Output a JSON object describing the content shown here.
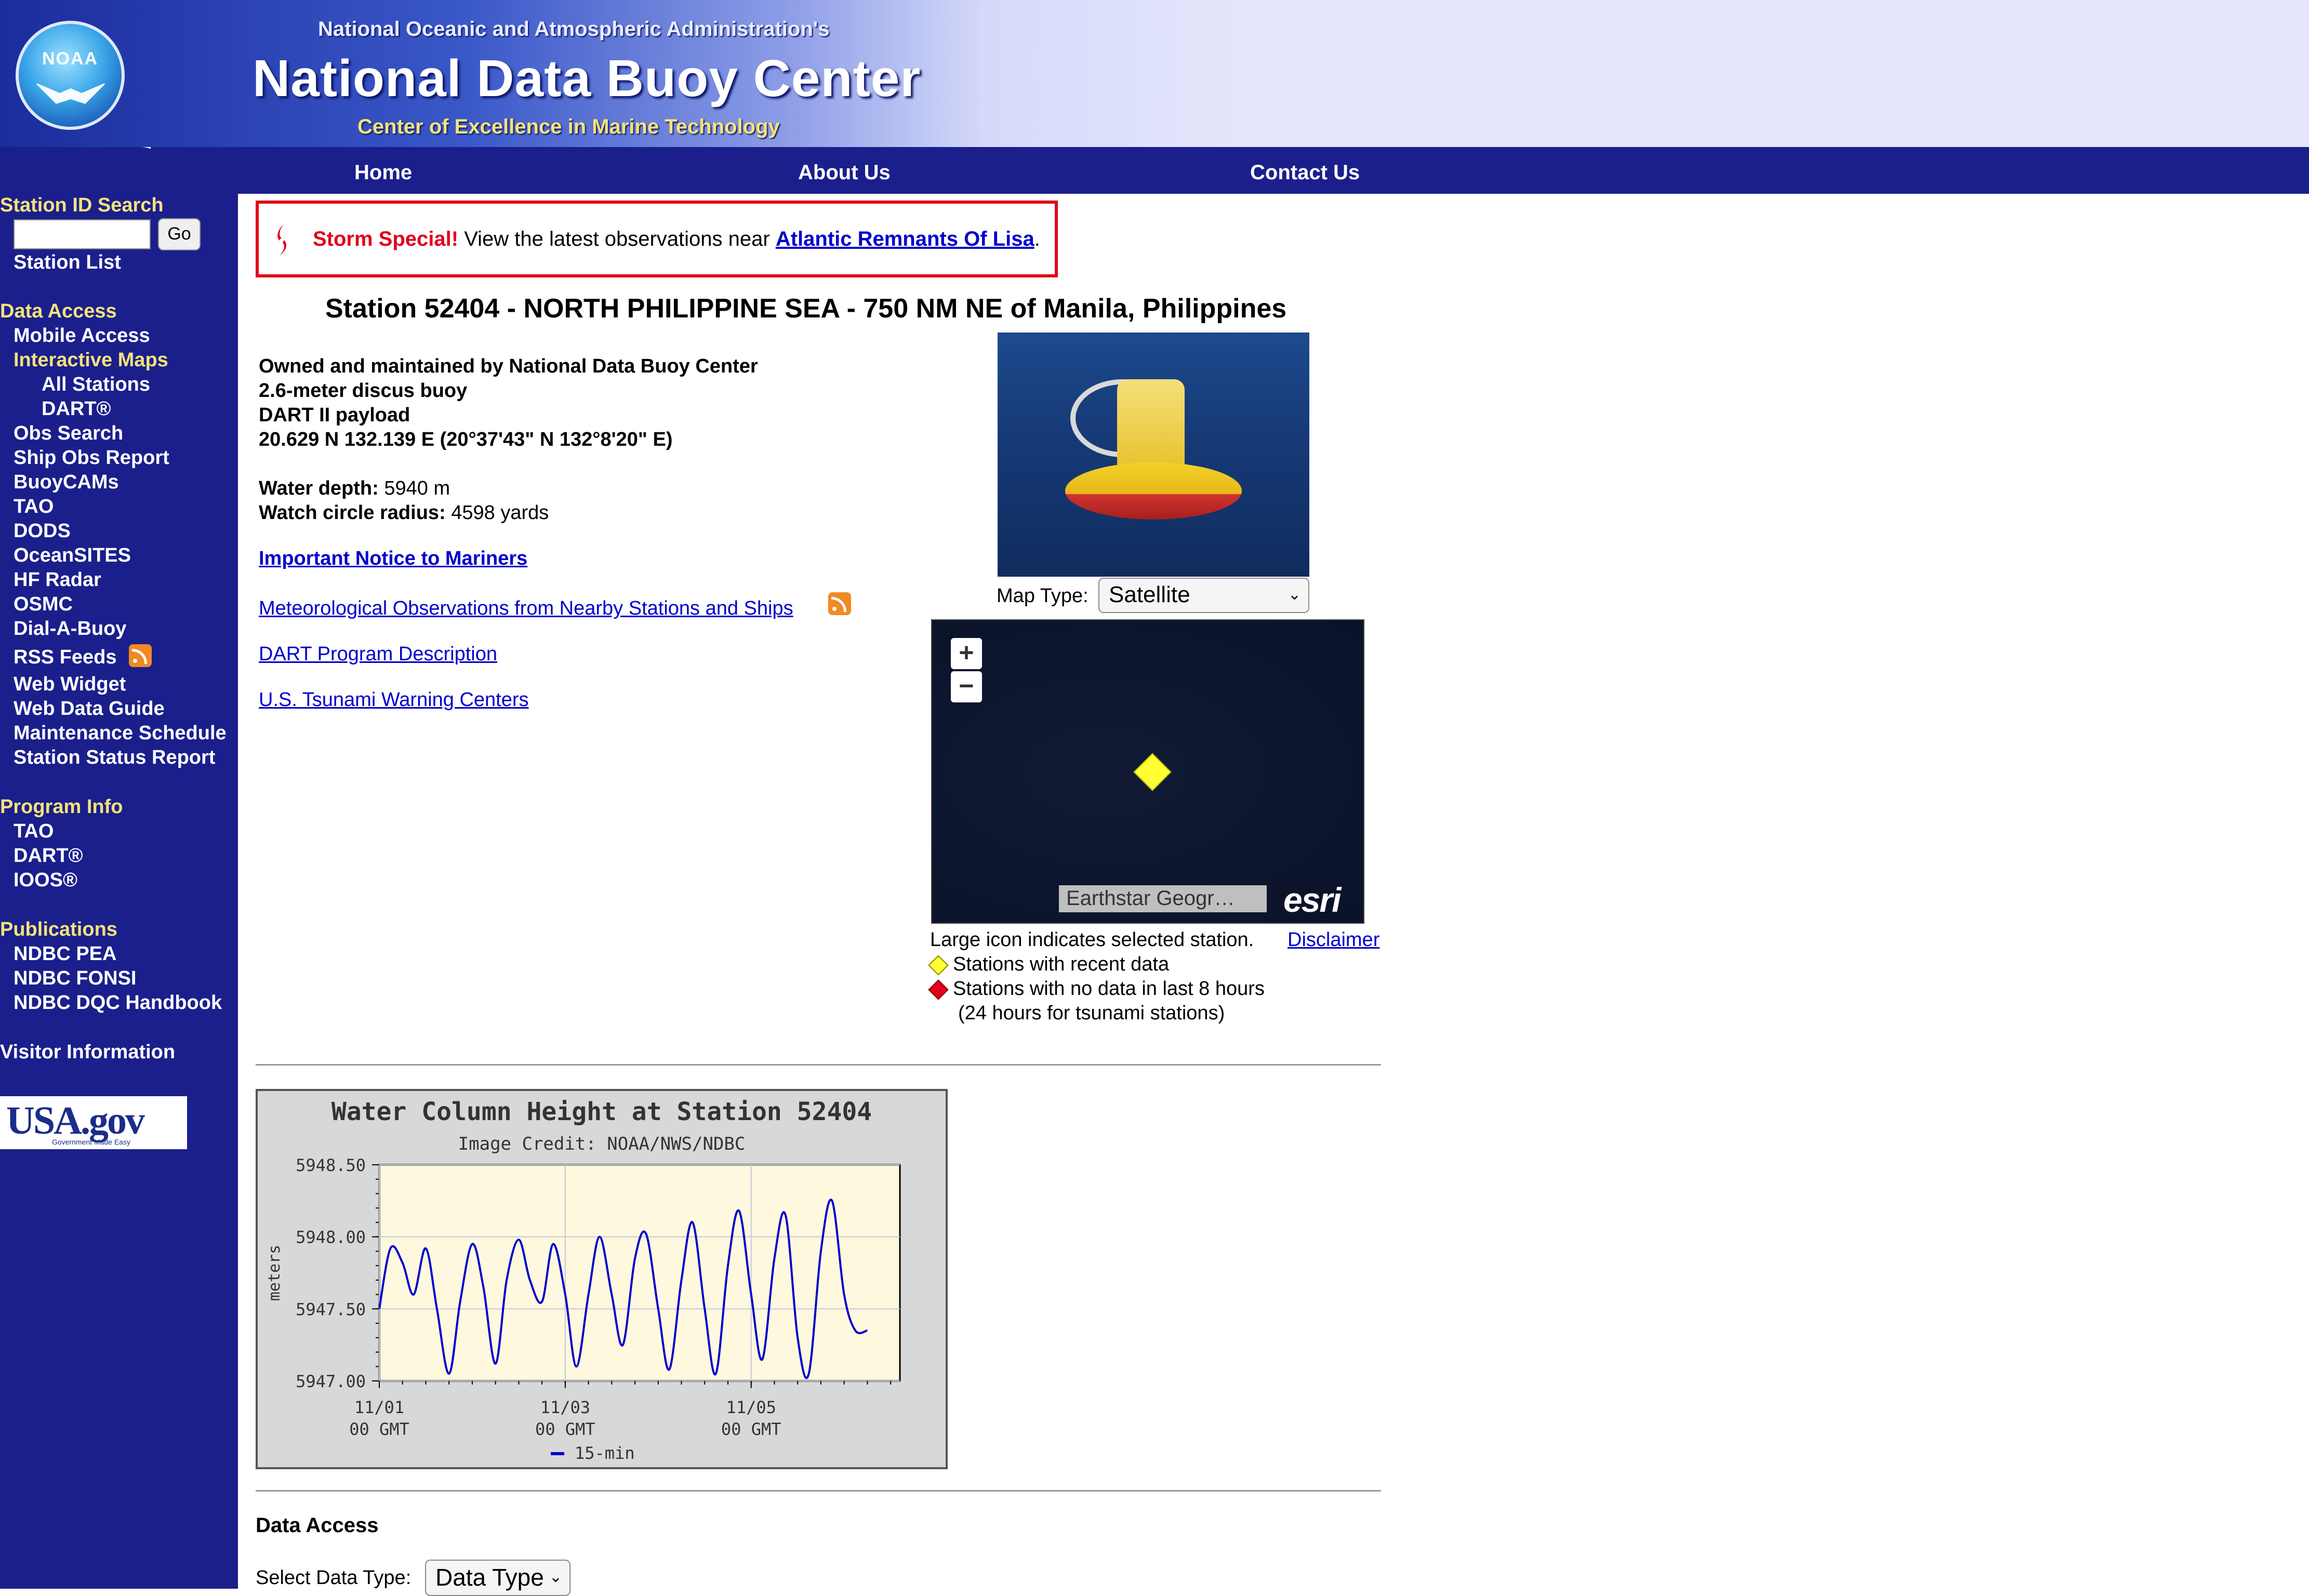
{
  "header": {
    "supertitle": "National Oceanic and Atmospheric Administration's",
    "title": "National Data Buoy Center",
    "tagline": "Center of Excellence in Marine Technology",
    "logo_text": "NOAA"
  },
  "nav": {
    "home": "Home",
    "about": "About Us",
    "contact": "Contact Us"
  },
  "sidebar": {
    "station_id_search": "Station ID Search",
    "go_label": "Go",
    "station_list": "Station List",
    "data_access": "Data Access",
    "mobile_access": "Mobile Access",
    "interactive_maps": "Interactive Maps",
    "all_stations": "All Stations",
    "dart": "DART®",
    "obs_search": "Obs Search",
    "ship_obs_report": "Ship Obs Report",
    "buoycams": "BuoyCAMs",
    "tao": "TAO",
    "dods": "DODS",
    "oceansites": "OceanSITES",
    "hf_radar": "HF Radar",
    "osmc": "OSMC",
    "dial_a_buoy": "Dial-A-Buoy",
    "rss_feeds": "RSS Feeds",
    "web_widget": "Web Widget",
    "web_data_guide": "Web Data Guide",
    "maintenance_schedule": "Maintenance Schedule",
    "station_status_report": "Station Status Report",
    "program_info": "Program Info",
    "program_tao": "TAO",
    "program_dart": "DART®",
    "program_ioos": "IOOS®",
    "publications": "Publications",
    "ndbc_pea": "NDBC PEA",
    "ndbc_fonsi": "NDBC FONSI",
    "ndbc_dqc": "NDBC DQC Handbook",
    "visitor_info": "Visitor Information",
    "usagov": "USA.gov",
    "usagov_tag": "Government Made Easy"
  },
  "storm": {
    "label": "Storm Special!",
    "text": " View the latest observations near ",
    "link": "Atlantic Remnants Of Lisa",
    "end": "."
  },
  "station": {
    "title": "Station 52404 - NORTH PHILIPPINE SEA - 750 NM NE of Manila, Philippines",
    "owner": "Owned and maintained by National Data Buoy Center",
    "buoy_type": "2.6-meter discus buoy",
    "payload": "DART II payload",
    "location": "20.629 N 132.139 E (20°37'43\" N 132°8'20\" E)",
    "water_depth_label": "Water depth:",
    "water_depth_value": " 5940 m",
    "watch_circle_label": "Watch circle radius:",
    "watch_circle_value": " 4598 yards",
    "notice_link": "Important Notice to Mariners",
    "met_obs_link": "Meteorological Observations from Nearby Stations and Ships",
    "dart_desc_link": "DART Program Description",
    "tsunami_link": "U.S. Tsunami Warning Centers"
  },
  "map": {
    "type_label": "Map Type:",
    "type_value": "Satellite",
    "zoom_in": "+",
    "zoom_out": "−",
    "attribution": "Earthstar Geogr…",
    "esri": "esri",
    "large_icon_note": "Large icon indicates selected station.",
    "disclaimer": "Disclaimer",
    "legend_recent": "Stations with recent data",
    "legend_nodata": "Stations with no data in last 8 hours",
    "legend_nodata_note": "(24 hours for tsunami stations)",
    "recent_color": "#ffff33",
    "nodata_color": "#e0001b"
  },
  "chart_data": {
    "type": "line",
    "title": "Water Column Height at Station 52404",
    "subtitle": "Image Credit: NOAA/NWS/NDBC",
    "ylabel": "meters",
    "ylim": [
      5947.0,
      5948.5
    ],
    "yticks": [
      "5948.50",
      "5948.00",
      "5947.50",
      "5947.00"
    ],
    "xticks": [
      {
        "date": "11/01",
        "time": "00 GMT"
      },
      {
        "date": "11/03",
        "time": "00 GMT"
      },
      {
        "date": "11/05",
        "time": "00 GMT"
      }
    ],
    "x_days": [
      0,
      0.12,
      0.25,
      0.37,
      0.5,
      0.62,
      0.75,
      0.87,
      1.0,
      1.12,
      1.25,
      1.37,
      1.5,
      1.62,
      1.75,
      1.87,
      2.0,
      2.12,
      2.25,
      2.37,
      2.5,
      2.62,
      2.75,
      2.87,
      3.0,
      3.12,
      3.25,
      3.37,
      3.5,
      3.62,
      3.75,
      3.87,
      4.0,
      4.12,
      4.25,
      4.37,
      4.5,
      4.62,
      4.75,
      4.87,
      5.0,
      5.12,
      5.25
    ],
    "values": [
      5947.5,
      5947.92,
      5947.82,
      5947.6,
      5947.92,
      5947.5,
      5947.05,
      5947.55,
      5947.95,
      5947.65,
      5947.12,
      5947.7,
      5947.98,
      5947.7,
      5947.55,
      5947.95,
      5947.6,
      5947.1,
      5947.6,
      5948.0,
      5947.6,
      5947.25,
      5947.85,
      5948.02,
      5947.5,
      5947.08,
      5947.7,
      5948.1,
      5947.5,
      5947.05,
      5947.8,
      5948.18,
      5947.6,
      5947.15,
      5947.85,
      5948.15,
      5947.3,
      5947.05,
      5947.9,
      5948.25,
      5947.6,
      5947.35,
      5947.35
    ],
    "series": [
      {
        "name": "15-min",
        "color": "#0000cc"
      }
    ],
    "plot_bg": "#fdf8de",
    "grid": true
  },
  "data_access": {
    "title": "Data Access",
    "select_label": "Select Data Type:",
    "select_value": "Data Type"
  }
}
